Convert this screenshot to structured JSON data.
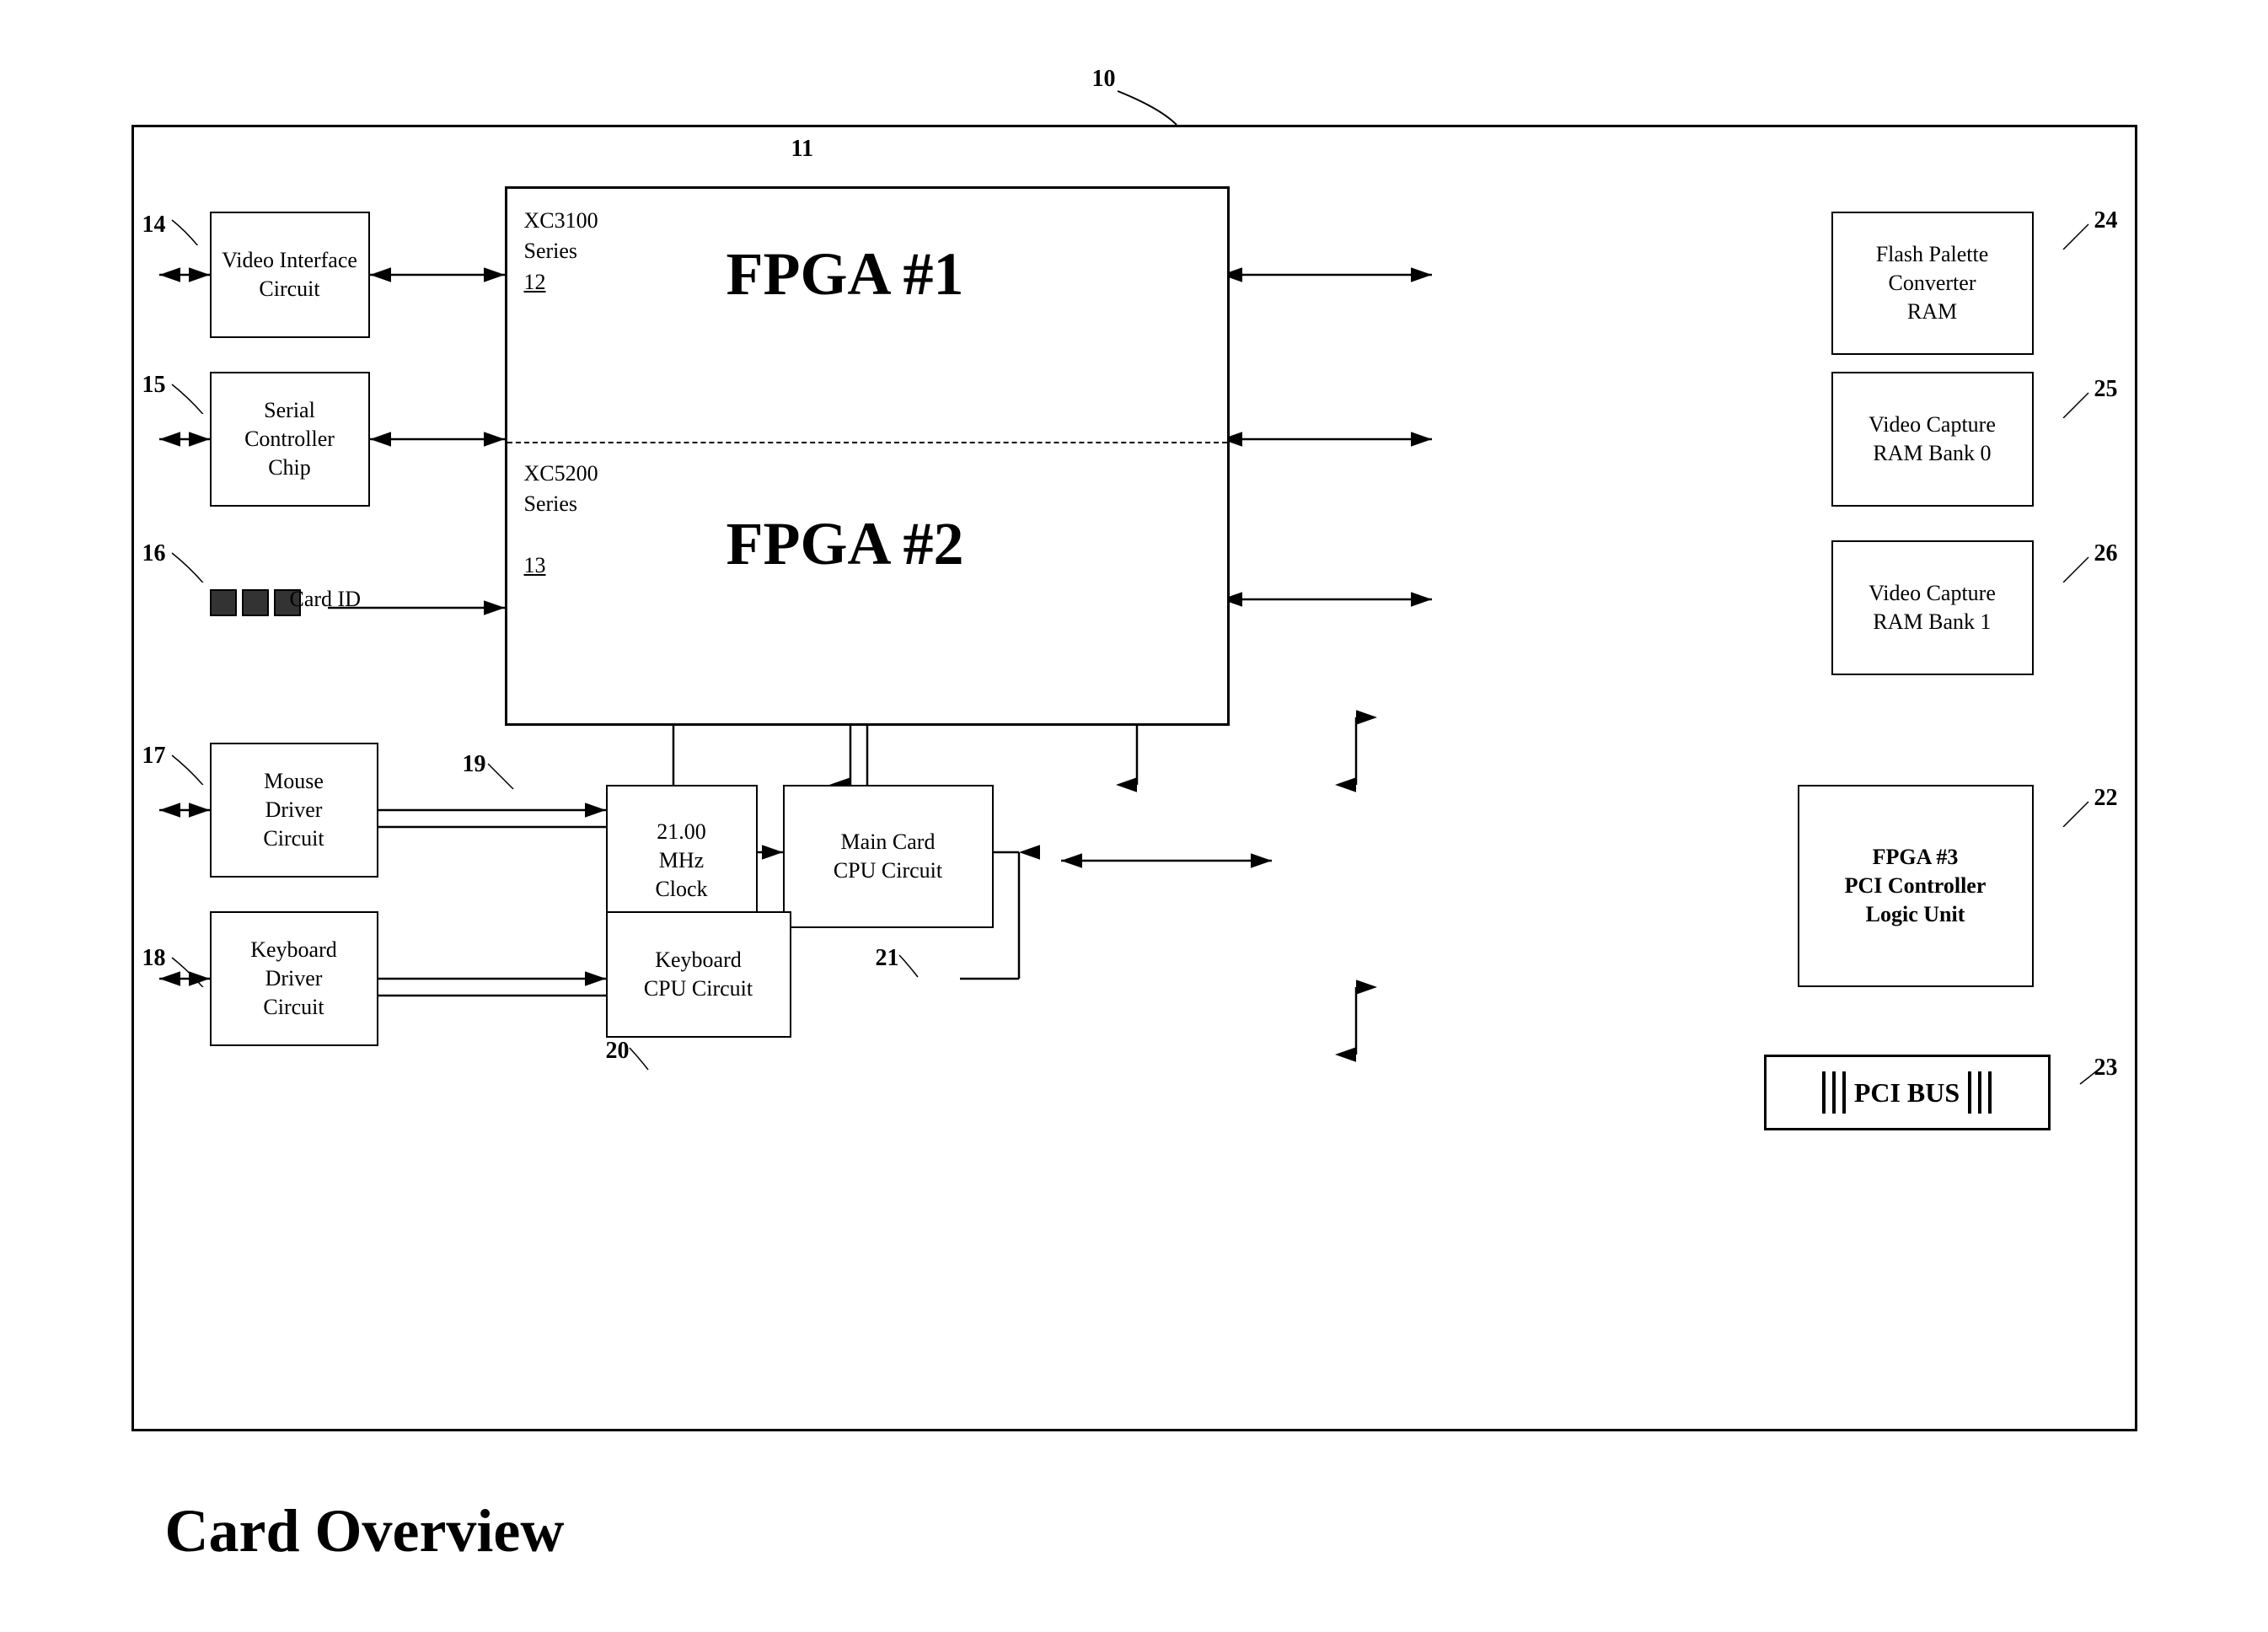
{
  "diagram": {
    "title": "Card Overview",
    "outer_ref": "10",
    "components": {
      "fpga_group": {
        "ref": "11",
        "fpga1": {
          "label": "FPGA  #1",
          "series_top": "XC3100\nSeries",
          "series_top_ref": "12",
          "series_bottom": "XC5200\nSeries",
          "series_bottom_ref": "13",
          "fpga2_label": "FPGA  #2"
        },
        "fpga3": {
          "ref": "22",
          "label": "FPGA #3\nPCI Controller\nLogic Unit"
        }
      },
      "left_components": {
        "video_interface": {
          "ref": "14",
          "label": "Video\nInterface\nCircuit"
        },
        "serial_controller": {
          "ref": "15",
          "label": "Serial\nController\nChip"
        },
        "card_id": {
          "ref": "16",
          "label": "Card ID"
        },
        "mouse_driver": {
          "ref": "17",
          "label": "Mouse\nDriver\nCircuit"
        },
        "keyboard_driver": {
          "ref": "18",
          "label": "Keyboard\nDriver\nCircuit"
        }
      },
      "bottom_components": {
        "clock": {
          "ref": "19",
          "label": "21.00\nMHz\nClock"
        },
        "main_cpu": {
          "ref": "21",
          "label": "Main Card\nCPU Circuit"
        },
        "keyboard_cpu": {
          "ref": "20",
          "label": "Keyboard\nCPU Circuit"
        }
      },
      "right_components": {
        "flash_palette": {
          "ref": "24",
          "label": "Flash Palette\nConverter\nRAM"
        },
        "video_capture_0": {
          "ref": "25",
          "label": "Video Capture\nRAM Bank 0"
        },
        "video_capture_1": {
          "ref": "26",
          "label": "Video Capture\nRAM Bank 1"
        }
      },
      "pci_bus": {
        "ref": "23",
        "label": "PCI  BUS"
      }
    }
  }
}
